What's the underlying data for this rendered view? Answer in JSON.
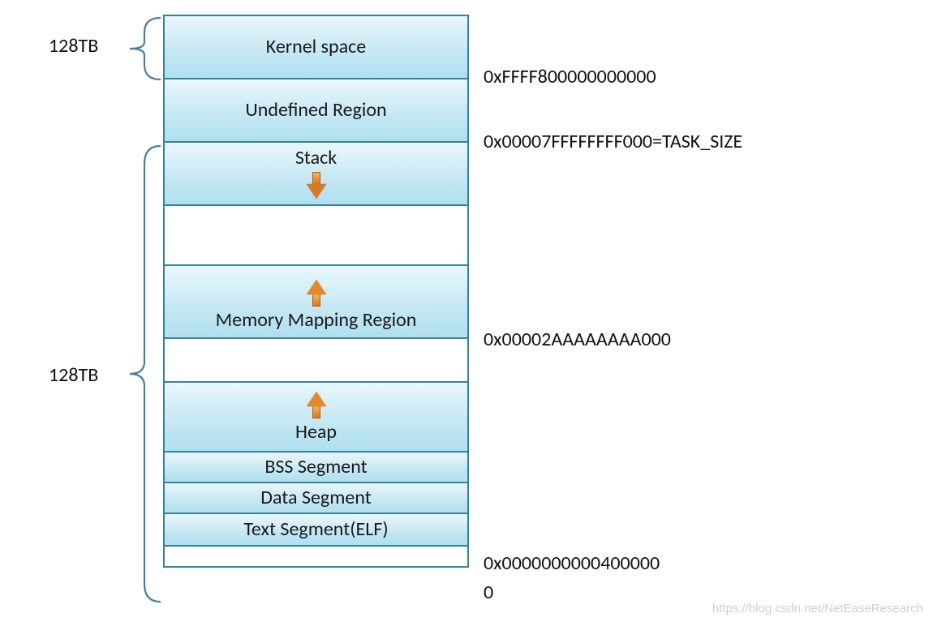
{
  "diagram": {
    "sizes": {
      "top": "128TB",
      "bottom": "128TB"
    },
    "segments": {
      "kernel": "Kernel space",
      "undefined": "Undefined Region",
      "stack": "Stack",
      "gap1": "",
      "mmap": "Memory Mapping Region",
      "gap2": "",
      "heap": "Heap",
      "bss": "BSS Segment",
      "data": "Data Segment",
      "text": "Text Segment(ELF)",
      "zero": ""
    },
    "addresses": {
      "kernel_base": "0xFFFF800000000000",
      "task_size": "0x00007FFFFFFFF000=TASK_SIZE",
      "mmap_base": "0x00002AAAAAAAA000",
      "text_base": "0x0000000000400000",
      "zero": "0"
    },
    "watermark": "https://blog.csdn.net/NetEaseResearch"
  }
}
